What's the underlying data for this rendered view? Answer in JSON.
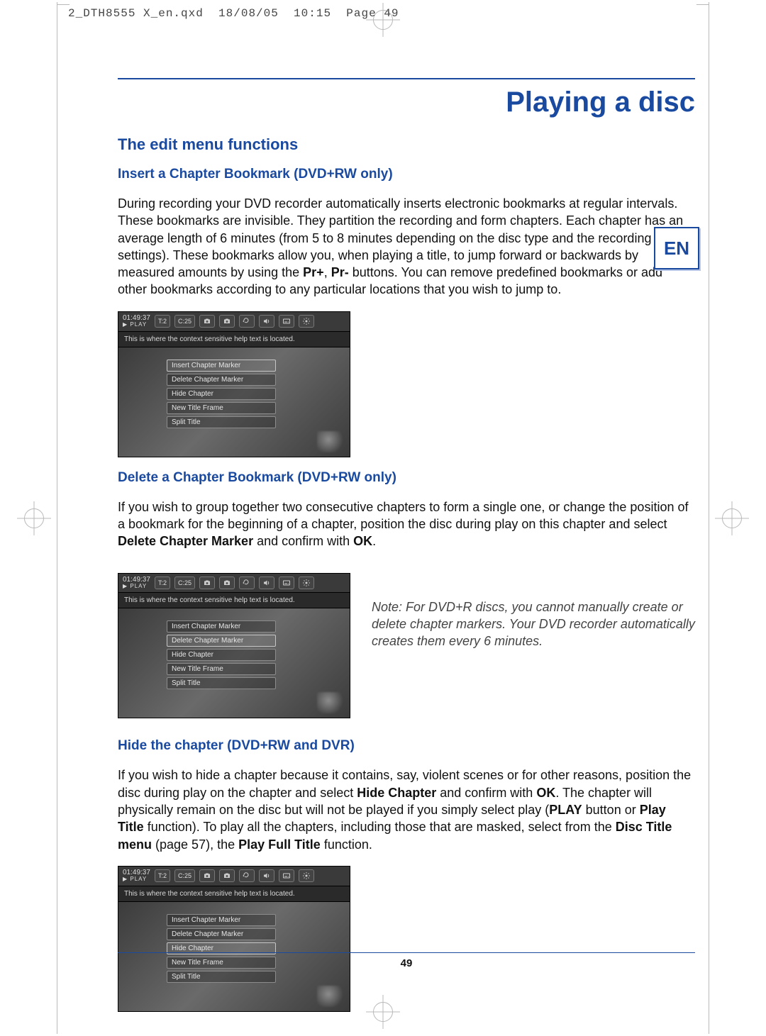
{
  "meta_line": "2_DTH8555 X_en.qxd  18/08/05  10:15  Page 49",
  "page_title": "Playing a disc",
  "lang_badge": "EN",
  "page_number": "49",
  "h2": "The edit menu functions",
  "sections": {
    "insert": {
      "h3": "Insert a Chapter Bookmark (DVD+RW only)",
      "body_parts": [
        "During recording your DVD recorder automatically inserts electronic bookmarks at regular intervals. These bookmarks are invisible. They partition the recording and form chapters. Each chapter has an average length of 6 minutes (from 5 to 8 minutes depending on the disc type and the recording settings). These bookmarks allow you, when playing a title, to jump forward or backwards by measured amounts by using the ",
        "Pr+",
        ", ",
        "Pr-",
        " buttons. You can remove predefined bookmarks or add other bookmarks according to any particular locations that you wish to jump to."
      ]
    },
    "delete": {
      "h3": "Delete a Chapter Bookmark (DVD+RW only)",
      "body_parts": [
        "If you wish to group together two consecutive chapters to form a single one, or change the position of a bookmark for the beginning of a chapter, position the disc during play on this chapter and select ",
        "Delete Chapter Marker",
        " and confirm with ",
        "OK",
        "."
      ],
      "note": "Note: For DVD+R discs, you cannot manually create or delete chapter markers. Your DVD recorder automatically creates them every 6 minutes."
    },
    "hide": {
      "h3": "Hide the chapter (DVD+RW and DVR)",
      "body_parts": [
        "If you wish to hide a chapter because it contains, say, violent scenes or for other reasons, position the disc during play on the chapter and select ",
        "Hide Chapter",
        " and confirm with ",
        "OK",
        ". The chapter will physically remain on the disc but will not be played if you simply select play (",
        "PLAY",
        " button or ",
        "Play Title",
        " function). To play all the chapters, including those that are masked, select from the ",
        "Disc Title menu",
        " (page 57), the ",
        "Play Full Title",
        " function."
      ]
    }
  },
  "osd": {
    "time": "01:49:37",
    "play_label": "PLAY",
    "chips": {
      "t": "T:2",
      "c": "C:25"
    },
    "help_text": "This is where the context sensitive help text is located.",
    "items": [
      "Insert Chapter Marker",
      "Delete Chapter Marker",
      "Hide Chapter",
      "New Title Frame",
      "Split Title"
    ],
    "selected": {
      "insert": 0,
      "delete": 1,
      "hide": 2
    }
  }
}
